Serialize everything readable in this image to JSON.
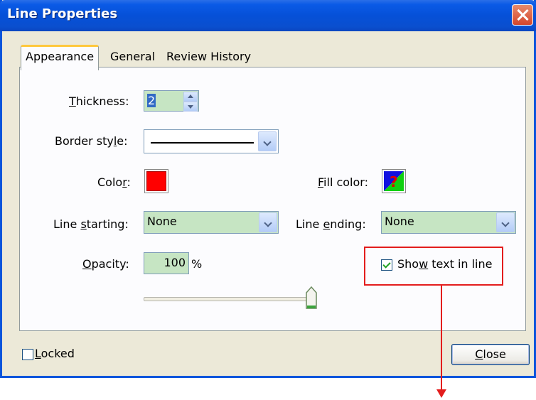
{
  "window": {
    "title": "Line Properties"
  },
  "tabs": [
    {
      "label": "Appearance",
      "active": true
    },
    {
      "label": "General",
      "active": false
    },
    {
      "label": "Review History",
      "active": false
    }
  ],
  "appearance": {
    "thickness": {
      "label": "Thickness:",
      "value": "2"
    },
    "border_style": {
      "label": "Border style:"
    },
    "color": {
      "label": "Color:",
      "value": "#ff0000"
    },
    "fill_color": {
      "label": "Fill color:"
    },
    "line_starting": {
      "label": "Line starting:",
      "value": "None"
    },
    "line_ending": {
      "label": "Line ending:",
      "value": "None"
    },
    "opacity": {
      "label": "Opacity:",
      "value": "100",
      "unit": "%",
      "slider_fraction": 1.0
    },
    "show_text_in_line": {
      "label": "Show text in line",
      "checked": true
    }
  },
  "footer": {
    "locked": {
      "label": "Locked",
      "checked": false
    },
    "close_label": "Close"
  },
  "annotation": {
    "highlight_color": "#e31d1d"
  }
}
